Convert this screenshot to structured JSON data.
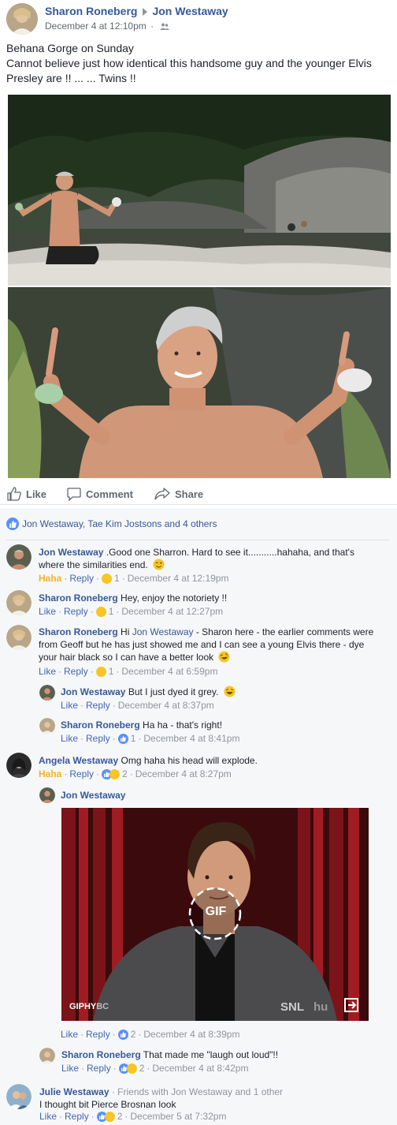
{
  "post": {
    "author": "Sharon Roneberg",
    "target": "Jon Westaway",
    "timestamp": "December 4 at 12:10pm",
    "lines": [
      "Behana Gorge on Sunday",
      "Cannot believe just how identical this handsome guy and the younger Elvis",
      "Presley are !! ... ... Twins !!"
    ]
  },
  "actions": {
    "like": "Like",
    "comment": "Comment",
    "share": "Share"
  },
  "reactions_summary": "Jon Westaway, Tae Kim Jostsons and 4 others",
  "comments": [
    {
      "name": "Jon Westaway",
      "text1": " .Good one Sharron. Hard to see it...........hahaha, and that's",
      "text2": "where the similarities end.",
      "reaction": "Haha",
      "reply": "Reply",
      "count": "1",
      "time": "December 4 at 12:19pm"
    },
    {
      "name": "Sharon Roneberg",
      "text1": " Hey, enjoy the notoriety !!",
      "reaction": "Like",
      "reply": "Reply",
      "count": "1",
      "time": "December 4 at 12:27pm"
    },
    {
      "name": "Sharon Roneberg",
      "text1a": " Hi ",
      "mention": "Jon Westaway",
      "text1b": " - Sharon here - the earlier comments were",
      "text2": "from Geoff but he has just showed me and I can see a young Elvis there - dye",
      "text3": "your hair black so I can have a better look",
      "reaction": "Like",
      "reply": "Reply",
      "count": "1",
      "time": "December 4 at 6:59pm"
    },
    {
      "name": "Jon Westaway",
      "text1": " But I just dyed it grey.",
      "reaction": "Like",
      "reply": "Reply",
      "time": "December 4 at 8:37pm"
    },
    {
      "name": "Sharon Roneberg",
      "text1": " Ha ha - that's right!",
      "reaction": "Like",
      "reply": "Reply",
      "count": "1",
      "time": "December 4 at 8:41pm"
    },
    {
      "name": "Angela Westaway",
      "text1": " Omg haha his head will explode.",
      "reaction": "Haha",
      "reply": "Reply",
      "count": "2",
      "time": "December 4 at 8:27pm"
    },
    {
      "name": "Jon Westaway",
      "reaction": "Like",
      "reply": "Reply",
      "count": "2",
      "time": "December 4 at 8:39pm"
    },
    {
      "name": "Sharon Roneberg",
      "text1": " That made me \"laugh out loud\"!!",
      "reaction": "Like",
      "reply": "Reply",
      "count": "2",
      "time": "December 4 at 8:42pm"
    },
    {
      "name": "Julie Westaway",
      "friends": " · Friends with Jon Westaway and 1 other",
      "text1": "I thought bit Pierce Brosnan look",
      "reaction": "Like",
      "reply": "Reply",
      "count": "2",
      "time": "December 5 at 7:32pm"
    }
  ],
  "gif": {
    "badge": "GIF",
    "source": "GIPHY",
    "source_tail": "BC",
    "show": "SNL",
    "brand": "hu"
  },
  "colors": {
    "link": "#365899",
    "haha": "#f7b125",
    "like": "#4267b2",
    "meta": "#90949c",
    "comments_bg": "#f6f7f9"
  }
}
